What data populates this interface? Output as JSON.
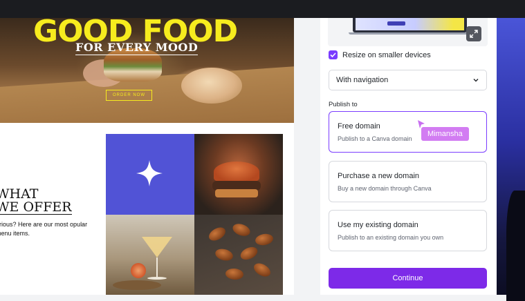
{
  "website": {
    "hero_title": "GOOD FOOD",
    "hero_subtitle": "FOR EVERY MOOD",
    "hero_button": "ORDER NOW",
    "offer_title_line1": "WHAT",
    "offer_title_line2": "WE OFFER",
    "offer_text": "urious? Here are our most opular menu items."
  },
  "panel": {
    "resize_label": "Resize on smaller devices",
    "resize_checked": true,
    "navigation_select": "With navigation",
    "publish_to_label": "Publish to",
    "options": [
      {
        "title": "Free domain",
        "desc": "Publish to a Canva domain",
        "selected": true
      },
      {
        "title": "Purchase a new domain",
        "desc": "Buy a new domain through Canva",
        "selected": false
      },
      {
        "title": "Use my existing domain",
        "desc": "Publish to an existing domain you own",
        "selected": false
      }
    ],
    "collaborator_name": "Mimansha",
    "continue_label": "Continue"
  },
  "colors": {
    "accent": "#7d2ae8",
    "hero_yellow": "#f7ec1e",
    "tile_purple": "#5153d6",
    "collaborator": "#d27cf2"
  },
  "icons": {
    "expand": "expand-icon",
    "check": "check-icon",
    "dropdown": "chevron-down-icon",
    "star": "sparkle-star-icon",
    "cursor": "cursor-pointer-icon"
  }
}
